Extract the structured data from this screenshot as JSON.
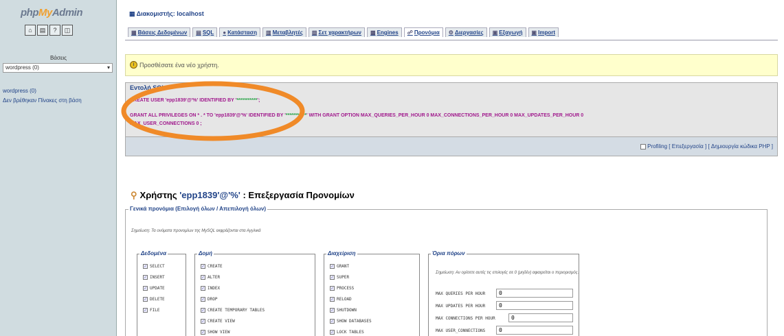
{
  "left": {
    "logo": {
      "a": "php",
      "b": "My",
      "c": "Admin"
    },
    "toolbar_icons": [
      "home-icon",
      "query-window-icon",
      "docs-icon",
      "sql-docs-icon"
    ],
    "databases_label": "Βάσεις",
    "db_select": "wordpress (0)",
    "db_link": "wordpress (0)",
    "no_tables": "Δεν βρέθηκαν Πίνακες στη βάση"
  },
  "server": "Διακομιστής: localhost",
  "tabs": [
    {
      "label": "Βάσεις Δεδομένων",
      "icon": "database-icon"
    },
    {
      "label": "SQL",
      "icon": "sql-icon"
    },
    {
      "label": "Κατάσταση",
      "icon": "status-icon"
    },
    {
      "label": "Μεταβλητές",
      "icon": "variables-icon"
    },
    {
      "label": "Σετ χαρακτήρων",
      "icon": "charset-icon"
    },
    {
      "label": "Engines",
      "icon": "engines-icon"
    },
    {
      "label": "Προνόμια",
      "icon": "privileges-icon"
    },
    {
      "label": "Διεργασίες",
      "icon": "processes-icon"
    },
    {
      "label": "Εξαγωγή",
      "icon": "export-icon"
    },
    {
      "label": "Import",
      "icon": "import-icon"
    }
  ],
  "active_tab": "Προνόμια",
  "notice": "Προσθέσατε ένα νέο χρήστη.",
  "sql": {
    "legend": "Εντολή SQL:",
    "line1_a": "CREATE USER 'epp1839'@'%' IDENTIFIED BY '",
    "line1_b": "***********",
    "line1_c": "';",
    "line2_a": "GRANT ALL PRIVILEGES ON * . * TO 'epp1839'@'%' IDENTIFIED BY '",
    "line2_b": "***********",
    "line2_c": "' WITH GRANT OPTION MAX_QUERIES_PER_HOUR 0 MAX_CONNECTIONS_PER_HOUR 0 MAX_UPDATES_PER_HOUR 0",
    "line3": "MAX_USER_CONNECTIONS 0 ;",
    "profiling": "Profiling",
    "edit_link": "[ Επεξεργασία ]",
    "php_link": "[ Δημιουργία κώδικα PHP ]"
  },
  "user_title": {
    "prefix": "Χρήστης",
    "name": "'epp1839'@'%'",
    "suffix": ": Επεξεργασία Προνομίων"
  },
  "privileges": {
    "legend": "Γενικά προνόμια (Επιλογή όλων / Απεπιλογή όλων)",
    "note": "Σημείωση: Τα ονόματα προνομίων της MySQL εκφράζονται στα Αγγλικά",
    "groups": [
      {
        "label": "Δεδομένα",
        "items": [
          "SELECT",
          "INSERT",
          "UPDATE",
          "DELETE",
          "FILE"
        ]
      },
      {
        "label": "Δομή",
        "items": [
          "CREATE",
          "ALTER",
          "INDEX",
          "DROP",
          "CREATE TEMPORARY TABLES",
          "CREATE VIEW",
          "SHOW VIEW"
        ]
      },
      {
        "label": "Διαχείριση",
        "items": [
          "GRANT",
          "SUPER",
          "PROCESS",
          "RELOAD",
          "SHUTDOWN",
          "SHOW DATABASES",
          "LOCK TABLES"
        ]
      }
    ],
    "limits": {
      "label": "Όρια πόρων",
      "note": "Σημείωση: Αν ορίσετε αυτές τις επιλογές σε 0 (μηδέν) αφαιρείται ο περιορισμός.",
      "rows": [
        {
          "name": "MAX QUERIES PER HOUR",
          "value": "0"
        },
        {
          "name": "MAX UPDATES PER HOUR",
          "value": "0"
        },
        {
          "name": "MAX CONNECTIONS PER HOUR",
          "value": "0"
        },
        {
          "name": "MAX USER_CONNECTIONS",
          "value": "0"
        }
      ]
    }
  },
  "colors": {
    "annotation": "#f08a28",
    "notice_bg": "#ffffcc",
    "left_bg": "#d0dce0"
  }
}
